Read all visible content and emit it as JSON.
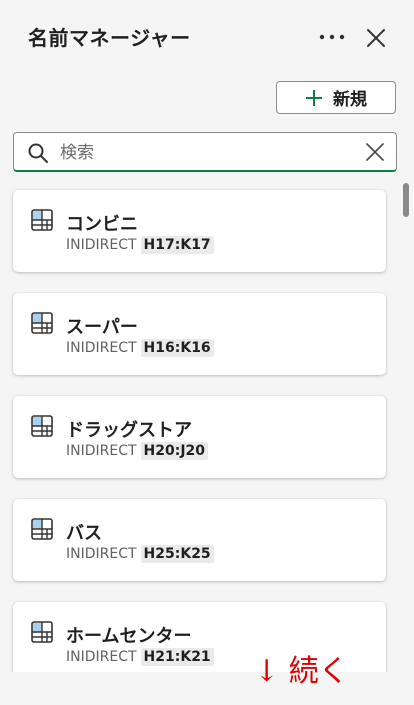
{
  "header": {
    "title": "名前マネージャー",
    "more_icon": "more-horizontal-icon",
    "close_icon": "close-icon"
  },
  "toolbar": {
    "new_label": "新規",
    "new_icon": "plus-icon",
    "accent_color": "#107c41"
  },
  "search": {
    "placeholder": "検索",
    "value": "",
    "search_icon": "search-icon",
    "clear_icon": "clear-icon"
  },
  "names": [
    {
      "name": "コンビニ",
      "function": "INIDIRECT",
      "range": "H17:K17"
    },
    {
      "name": "スーパー",
      "function": "INIDIRECT",
      "range": "H16:K16"
    },
    {
      "name": "ドラッグストア",
      "function": "INIDIRECT",
      "range": "H20:J20"
    },
    {
      "name": "バス",
      "function": "INIDIRECT",
      "range": "H25:K25"
    },
    {
      "name": "ホームセンター",
      "function": "INIDIRECT",
      "range": "H21:K21"
    }
  ],
  "annotation": {
    "text": "↓ 続く",
    "color": "#e00000"
  }
}
